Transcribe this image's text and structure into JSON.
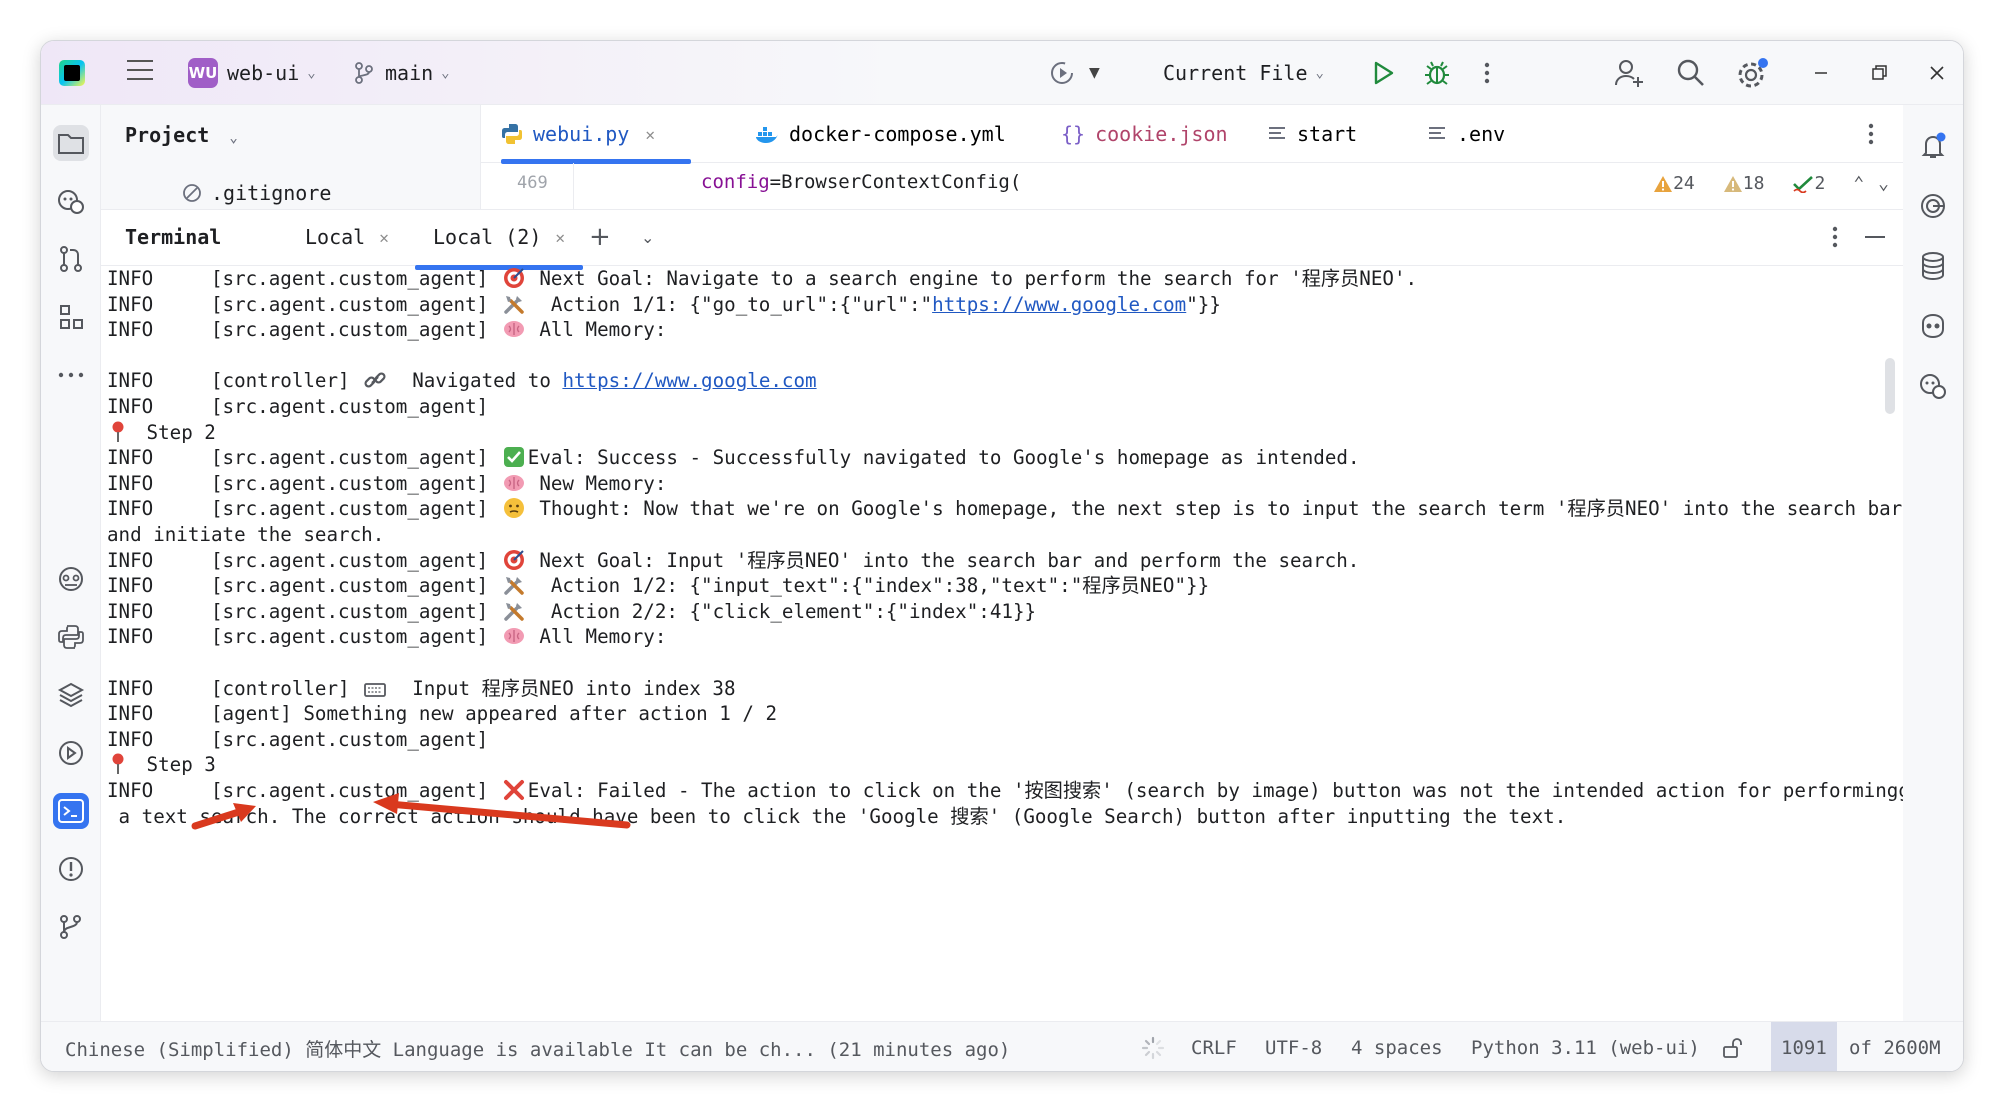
{
  "titlebar": {
    "project_badge": "WU",
    "project_name": "web-ui",
    "branch": "main",
    "run_config": "Current File"
  },
  "project_panel": {
    "title": "Project",
    "visible_item": ".gitignore"
  },
  "editor": {
    "tabs": [
      {
        "label": "webui.py",
        "icon": "python-icon",
        "active": true,
        "closable": true
      },
      {
        "label": "docker-compose.yml",
        "icon": "docker-icon",
        "active": false
      },
      {
        "label": "cookie.json",
        "icon": "json-icon",
        "active": false
      },
      {
        "label": "start",
        "icon": "text-file-icon",
        "active": false
      },
      {
        "label": ".env",
        "icon": "text-file-icon",
        "active": false
      }
    ],
    "line_number": "469",
    "code_param": "config",
    "code_rest": "=BrowserContextConfig(",
    "inspections": {
      "warnings": "24",
      "weak_warnings": "18",
      "ok": "2"
    }
  },
  "terminal": {
    "title": "Terminal",
    "tabs": [
      {
        "label": "Local",
        "active": false
      },
      {
        "label": "Local (2)",
        "active": true
      }
    ],
    "lines": [
      {
        "pre": "INFO     [src.agent.custom_agent] ",
        "emoji": "target",
        "text": " Next Goal: Navigate to a search engine to perform the search for '程序员NEO'."
      },
      {
        "pre": "INFO     [src.agent.custom_agent] ",
        "emoji": "tools",
        "text": "  Action 1/1: {\"go_to_url\":{\"url\":\"",
        "link": "https://www.google.com",
        "post": "\"}}"
      },
      {
        "pre": "INFO     [src.agent.custom_agent] ",
        "emoji": "brain",
        "text": " All Memory:"
      },
      {
        "pre": "",
        "text": ""
      },
      {
        "pre": "INFO     [controller] ",
        "emoji": "link",
        "text": "  Navigated to ",
        "link": "https://www.google.com",
        "post": ""
      },
      {
        "pre": "INFO     [src.agent.custom_agent]",
        "text": ""
      },
      {
        "pre": "",
        "emoji": "pin",
        "text": " Step 2"
      },
      {
        "pre": "INFO     [src.agent.custom_agent] ",
        "emoji": "check",
        "text": "Eval: Success - Successfully navigated to Google's homepage as intended."
      },
      {
        "pre": "INFO     [src.agent.custom_agent] ",
        "emoji": "brain",
        "text": " New Memory:"
      },
      {
        "pre": "INFO     [src.agent.custom_agent] ",
        "emoji": "think",
        "text": " Thought: Now that we're on Google's homepage, the next step is to input the search term '程序员NEO' into the search bar"
      },
      {
        "pre": "and initiate the search.",
        "text": ""
      },
      {
        "pre": "INFO     [src.agent.custom_agent] ",
        "emoji": "target",
        "text": " Next Goal: Input '程序员NEO' into the search bar and perform the search."
      },
      {
        "pre": "INFO     [src.agent.custom_agent] ",
        "emoji": "tools",
        "text": "  Action 1/2: {\"input_text\":{\"index\":38,\"text\":\"程序员NEO\"}}"
      },
      {
        "pre": "INFO     [src.agent.custom_agent] ",
        "emoji": "tools",
        "text": "  Action 2/2: {\"click_element\":{\"index\":41}}"
      },
      {
        "pre": "INFO     [src.agent.custom_agent] ",
        "emoji": "brain",
        "text": " All Memory:"
      },
      {
        "pre": "",
        "text": ""
      },
      {
        "pre": "INFO     [controller] ",
        "emoji": "keyboard",
        "text": "  Input 程序员NEO into index 38"
      },
      {
        "pre": "INFO     [agent] Something new appeared after action 1 / 2",
        "text": ""
      },
      {
        "pre": "INFO     [src.agent.custom_agent]",
        "text": ""
      },
      {
        "pre": "",
        "emoji": "pin",
        "text": " Step 3"
      },
      {
        "pre": "INFO     [src.agent.custom_agent] ",
        "emoji": "cross",
        "text": "Eval: Failed - The action to click on the '按图搜索' (search by image) button was not the intended action for performingg"
      },
      {
        "pre": " a text search. The correct action should have been to click the 'Google 搜索' (Google Search) button after inputting the text.",
        "text": ""
      }
    ]
  },
  "statusbar": {
    "notification": "Chinese (Simplified) 简体中文 Language is available It can be ch... (21 minutes ago)",
    "line_sep": "CRLF",
    "encoding": "UTF-8",
    "indent": "4 spaces",
    "interpreter": "Python 3.11 (web-ui)",
    "memory_used": "1091",
    "memory_of": "of 2600M"
  },
  "colors": {
    "accent": "#3574f0",
    "arrow": "#d9391e",
    "link": "#2058c2"
  }
}
